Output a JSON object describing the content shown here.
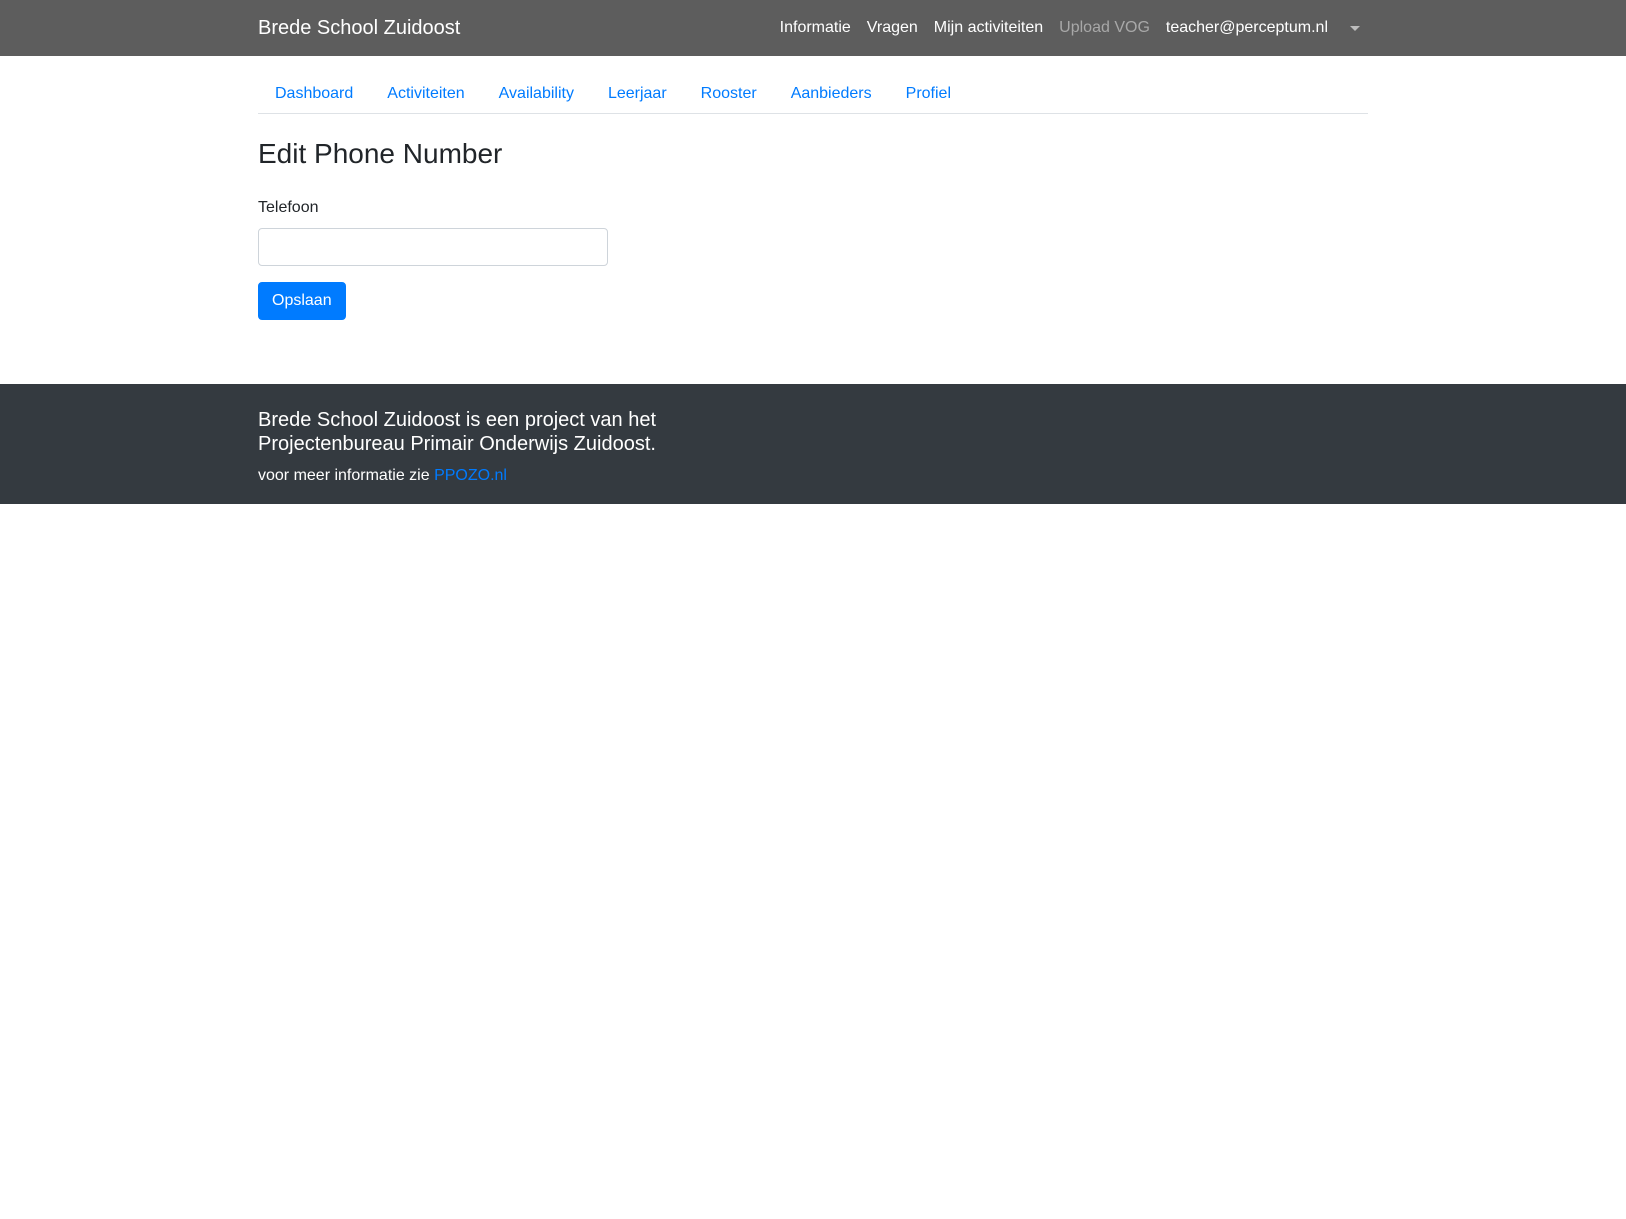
{
  "navbar": {
    "brand": "Brede School Zuidoost",
    "links": [
      {
        "label": "Informatie",
        "disabled": false
      },
      {
        "label": "Vragen",
        "disabled": false
      },
      {
        "label": "Mijn activiteiten",
        "disabled": false
      },
      {
        "label": "Upload VOG",
        "disabled": true
      }
    ],
    "user_email": "teacher@perceptum.nl",
    "user_menu_icon": "caret-down-icon"
  },
  "tabs": [
    {
      "label": "Dashboard"
    },
    {
      "label": "Activiteiten"
    },
    {
      "label": "Availability"
    },
    {
      "label": "Leerjaar"
    },
    {
      "label": "Rooster"
    },
    {
      "label": "Aanbieders"
    },
    {
      "label": "Profiel"
    }
  ],
  "main": {
    "title": "Edit Phone Number",
    "phone_label": "Telefoon",
    "phone_value": "",
    "phone_placeholder": "",
    "save_label": "Opslaan"
  },
  "footer": {
    "lead": "Brede School Zuidoost is een project van het Projectenbureau Primair Onderwijs Zuidoost.",
    "info_prefix": "voor meer informatie zie ",
    "info_link": "PPOZO.nl"
  },
  "colors": {
    "navbar_bg": "#5d5d5d",
    "link": "#007bff",
    "primary_button": "#007bff",
    "footer_bg": "#343a40",
    "disabled_nav": "#a8a8a8"
  }
}
